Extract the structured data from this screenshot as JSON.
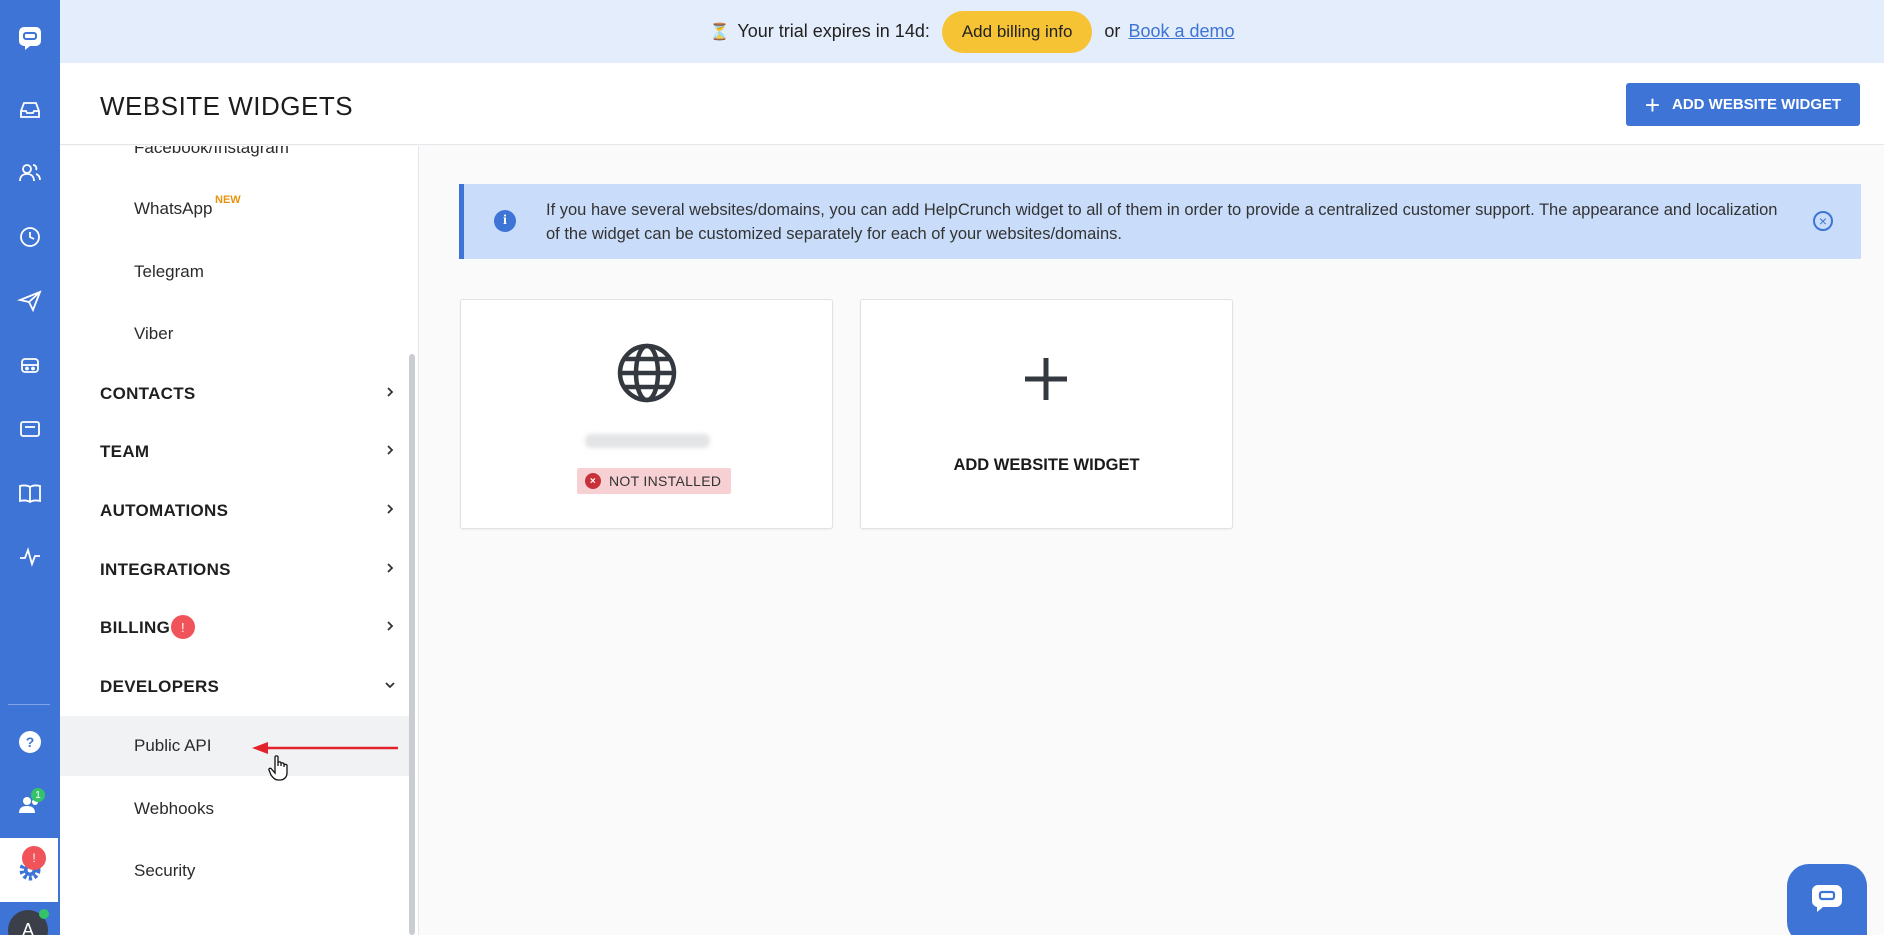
{
  "banner": {
    "hourglass_icon": "⏳",
    "trial_text": "Your trial expires in 14d:",
    "billing_button": "Add billing info",
    "or_text": "or",
    "demo_link": "Book a demo"
  },
  "header": {
    "title": "WEBSITE WIDGETS",
    "add_button": "ADD WEBSITE WIDGET",
    "add_icon": "+"
  },
  "rail": {
    "contacts_badge": "1",
    "settings_badge": "!",
    "avatar_letter": "A",
    "icons": [
      "chat-logo",
      "inbox",
      "contacts",
      "history",
      "send",
      "bot",
      "ticket",
      "knowledge-base",
      "activity",
      "help",
      "team",
      "settings"
    ]
  },
  "sidebar": {
    "channels": [
      {
        "label": "Facebook/Instagram"
      },
      {
        "label": "WhatsApp",
        "tag": "NEW"
      },
      {
        "label": "Telegram"
      },
      {
        "label": "Viber"
      }
    ],
    "sections": [
      {
        "label": "CONTACTS"
      },
      {
        "label": "TEAM"
      },
      {
        "label": "AUTOMATIONS"
      },
      {
        "label": "INTEGRATIONS"
      },
      {
        "label": "BILLING",
        "badge": "!"
      },
      {
        "label": "DEVELOPERS"
      }
    ],
    "developers_items": [
      {
        "label": "Public API"
      },
      {
        "label": "Webhooks"
      },
      {
        "label": "Security"
      }
    ]
  },
  "info_banner": {
    "text": "If you have several websites/domains, you can add HelpCrunch widget to all of them in order to provide a centralized customer support. The appearance and localization of the widget can be customized separately for each of your websites/domains.",
    "info_icon": "i",
    "close_icon": "×"
  },
  "widgets": [
    {
      "status": "NOT INSTALLED",
      "status_icon": "×"
    }
  ],
  "add_card": {
    "label": "ADD WEBSITE WIDGET"
  },
  "colors": {
    "brand": "#3e74d6",
    "banner_bg": "#e4edfb",
    "billing_button": "#f5c333",
    "info_bg": "#c9ddfa",
    "status_bg": "#f7d0d3",
    "alert": "#f0545a",
    "online": "#34c26a",
    "new_tag": "#e6930f"
  }
}
